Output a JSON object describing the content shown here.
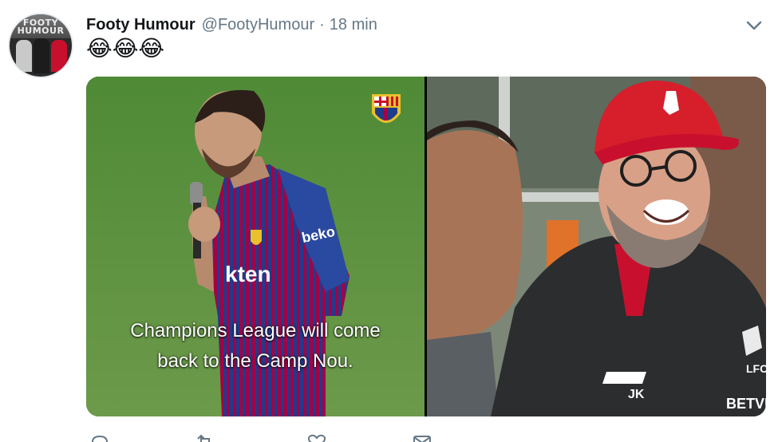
{
  "tweet": {
    "display_name": "Footy Humour",
    "handle": "@FootyHumour",
    "separator": "·",
    "time": "18 min",
    "text": "😂😂😂"
  },
  "avatar": {
    "text_line1": "FOOTY",
    "text_line2": "HUMOUR"
  },
  "media": {
    "left_image": {
      "caption_line1": "Champions League will come",
      "caption_line2": "back to the Camp Nou.",
      "shirt_sponsor": "kten",
      "sleeve_sponsor": "beko"
    },
    "right_image": {
      "jacket_initials": "JK",
      "crest_text": "LFC",
      "chest_sponsor": "BETVI"
    }
  },
  "colors": {
    "text_primary": "#14171a",
    "text_secondary": "#657786",
    "pitch_green": "#5c8f3e",
    "barca_blue": "#1f3b8c",
    "barca_red": "#a50044",
    "liverpool_red": "#c8102e"
  },
  "icons": {
    "more_menu": "chevron-down-icon",
    "reply": "reply-icon",
    "retweet": "retweet-icon",
    "like": "heart-icon",
    "message": "message-icon"
  }
}
